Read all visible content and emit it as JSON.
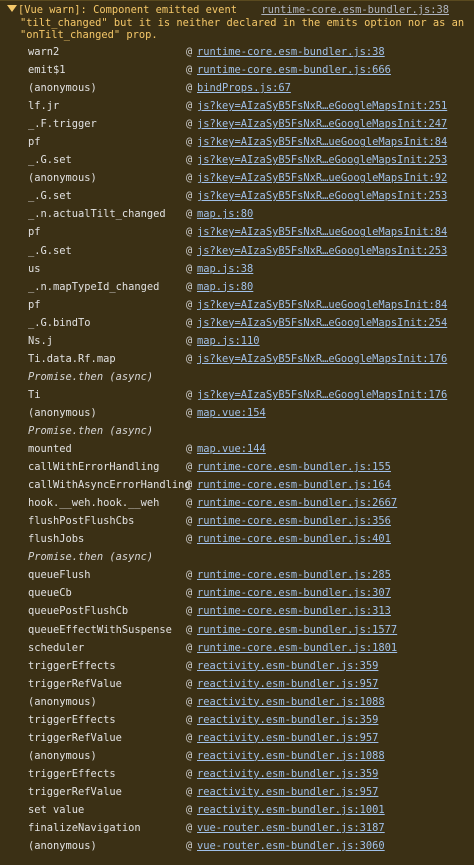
{
  "header": {
    "message_line1": "[Vue warn]: Component emitted event",
    "source_link": "runtime-core.esm-bundler.js:38",
    "message_line2": "\"tilt_changed\" but it is neither declared in the emits option nor as an",
    "message_line3": "\"onTilt_changed\" prop.",
    "color": "#f5c869"
  },
  "stack": [
    {
      "fn": "warn2",
      "loc": "runtime-core.esm-bundler.js:38"
    },
    {
      "fn": "emit$1",
      "loc": "runtime-core.esm-bundler.js:666"
    },
    {
      "fn": "(anonymous)",
      "loc": "bindProps.js:67"
    },
    {
      "fn": "lf.jr",
      "loc": "js?key=AIzaSyB5FsNxR…eGoogleMapsInit:251"
    },
    {
      "fn": "_.F.trigger",
      "loc": "js?key=AIzaSyB5FsNxR…eGoogleMapsInit:247"
    },
    {
      "fn": "pf",
      "loc": "js?key=AIzaSyB5FsNxR…ueGoogleMapsInit:84"
    },
    {
      "fn": "_.G.set",
      "loc": "js?key=AIzaSyB5FsNxR…eGoogleMapsInit:253"
    },
    {
      "fn": "(anonymous)",
      "loc": "js?key=AIzaSyB5FsNxR…ueGoogleMapsInit:92"
    },
    {
      "fn": "_.G.set",
      "loc": "js?key=AIzaSyB5FsNxR…eGoogleMapsInit:253"
    },
    {
      "fn": "_.n.actualTilt_changed",
      "loc": "map.js:80"
    },
    {
      "fn": "pf",
      "loc": "js?key=AIzaSyB5FsNxR…ueGoogleMapsInit:84"
    },
    {
      "fn": "_.G.set",
      "loc": "js?key=AIzaSyB5FsNxR…eGoogleMapsInit:253"
    },
    {
      "fn": "us",
      "loc": "map.js:38"
    },
    {
      "fn": "_.n.mapTypeId_changed",
      "loc": "map.js:80"
    },
    {
      "fn": "pf",
      "loc": "js?key=AIzaSyB5FsNxR…ueGoogleMapsInit:84"
    },
    {
      "fn": "_.G.bindTo",
      "loc": "js?key=AIzaSyB5FsNxR…eGoogleMapsInit:254"
    },
    {
      "fn": "Ns.j",
      "loc": "map.js:110"
    },
    {
      "fn": "Ti.data.Rf.map",
      "loc": "js?key=AIzaSyB5FsNxR…eGoogleMapsInit:176"
    },
    {
      "async": "Promise.then (async)"
    },
    {
      "fn": "Ti",
      "loc": "js?key=AIzaSyB5FsNxR…eGoogleMapsInit:176"
    },
    {
      "fn": "(anonymous)",
      "loc": "map.vue:154"
    },
    {
      "async": "Promise.then (async)"
    },
    {
      "fn": "mounted",
      "loc": "map.vue:144"
    },
    {
      "fn": "callWithErrorHandling",
      "loc": "runtime-core.esm-bundler.js:155"
    },
    {
      "fn": "callWithAsyncErrorHandling",
      "loc": "runtime-core.esm-bundler.js:164"
    },
    {
      "fn": "hook.__weh.hook.__weh",
      "loc": "runtime-core.esm-bundler.js:2667"
    },
    {
      "fn": "flushPostFlushCbs",
      "loc": "runtime-core.esm-bundler.js:356"
    },
    {
      "fn": "flushJobs",
      "loc": "runtime-core.esm-bundler.js:401"
    },
    {
      "async": "Promise.then (async)"
    },
    {
      "fn": "queueFlush",
      "loc": "runtime-core.esm-bundler.js:285"
    },
    {
      "fn": "queueCb",
      "loc": "runtime-core.esm-bundler.js:307"
    },
    {
      "fn": "queuePostFlushCb",
      "loc": "runtime-core.esm-bundler.js:313"
    },
    {
      "fn": "queueEffectWithSuspense",
      "loc": "runtime-core.esm-bundler.js:1577"
    },
    {
      "fn": "scheduler",
      "loc": "runtime-core.esm-bundler.js:1801"
    },
    {
      "fn": "triggerEffects",
      "loc": "reactivity.esm-bundler.js:359"
    },
    {
      "fn": "triggerRefValue",
      "loc": "reactivity.esm-bundler.js:957"
    },
    {
      "fn": "(anonymous)",
      "loc": "reactivity.esm-bundler.js:1088"
    },
    {
      "fn": "triggerEffects",
      "loc": "reactivity.esm-bundler.js:359"
    },
    {
      "fn": "triggerRefValue",
      "loc": "reactivity.esm-bundler.js:957"
    },
    {
      "fn": "(anonymous)",
      "loc": "reactivity.esm-bundler.js:1088"
    },
    {
      "fn": "triggerEffects",
      "loc": "reactivity.esm-bundler.js:359"
    },
    {
      "fn": "triggerRefValue",
      "loc": "reactivity.esm-bundler.js:957"
    },
    {
      "fn": "set value",
      "loc": "reactivity.esm-bundler.js:1001"
    },
    {
      "fn": "finalizeNavigation",
      "loc": "vue-router.esm-bundler.js:3187"
    },
    {
      "fn": "(anonymous)",
      "loc": "vue-router.esm-bundler.js:3060"
    }
  ],
  "at_symbol": "@"
}
